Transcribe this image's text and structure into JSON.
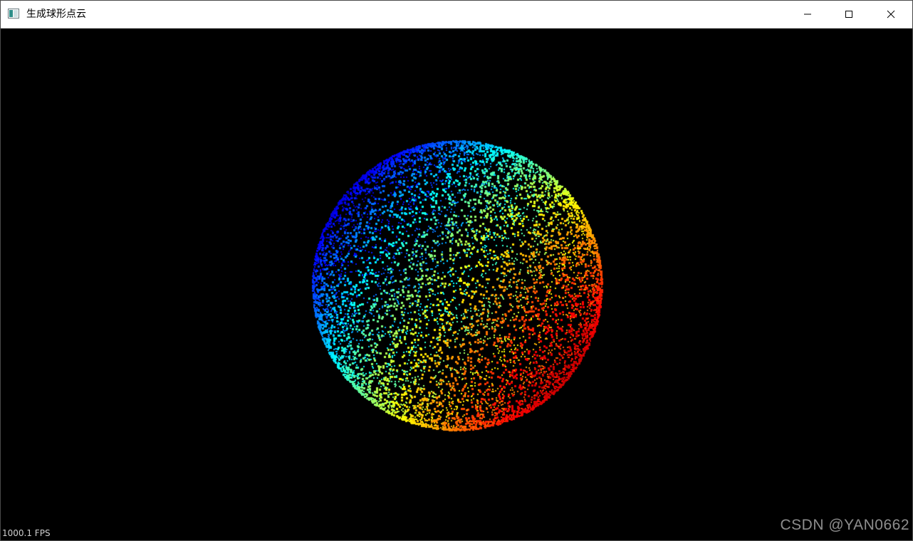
{
  "window": {
    "title": "生成球形点云",
    "icon": "app-window-icon"
  },
  "controls": {
    "minimize_icon": "minimize-icon",
    "maximize_icon": "maximize-icon",
    "close_icon": "close-icon"
  },
  "viewport": {
    "background": "#000000",
    "fps_text": "1000.1 FPS",
    "watermark": "CSDN @YAN0662"
  },
  "point_cloud": {
    "shape": "sphere",
    "colormap": "jet",
    "colors": [
      "#0000ff",
      "#00c8ff",
      "#00ff50",
      "#ffff00",
      "#ff0000"
    ]
  }
}
